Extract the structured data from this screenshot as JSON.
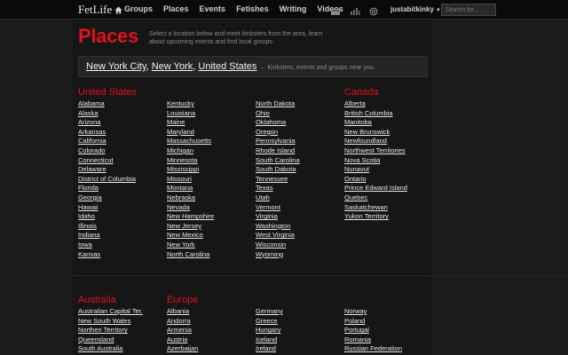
{
  "header": {
    "logo": "FetLife",
    "nav": [
      "Groups",
      "Places",
      "Events",
      "Fetishes",
      "Writing",
      "Videos"
    ],
    "username": "justabitkinky",
    "search_placeholder": "Search for..."
  },
  "page": {
    "title": "Places",
    "subtitle": "Select a location below and meet kinksters from the area, learn about upcoming events and find local groups."
  },
  "current_location": {
    "city": "New York City",
    "state": "New York",
    "country": "United States",
    "note": "← Kinksters, events and groups near you."
  },
  "regions": {
    "united_states": {
      "title": "United States",
      "columns": [
        [
          "Alabama",
          "Alaska",
          "Arizona",
          "Arkansas",
          "California",
          "Colorado",
          "Connecticut",
          "Delaware",
          "District of Columbia",
          "Florida",
          "Georgia",
          "Hawaii",
          "Idaho",
          "Illinois",
          "Indiana",
          "Iowa",
          "Kansas"
        ],
        [
          "Kentucky",
          "Louisiana",
          "Maine",
          "Maryland",
          "Massachusetts",
          "Michigan",
          "Minnesota",
          "Mississippi",
          "Missouri",
          "Montana",
          "Nebraska",
          "Nevada",
          "New Hampshire",
          "New Jersey",
          "New Mexico",
          "New York",
          "North Carolina"
        ],
        [
          "North Dakota",
          "Ohio",
          "Oklahoma",
          "Oregon",
          "Pennsylvania",
          "Rhode Island",
          "South Carolina",
          "South Dakota",
          "Tennessee",
          "Texas",
          "Utah",
          "Vermont",
          "Virginia",
          "Washington",
          "West Virginia",
          "Wisconsin",
          "Wyoming"
        ]
      ]
    },
    "canada": {
      "title": "Canada",
      "items": [
        "Alberta",
        "British Columbia",
        "Manitoba",
        "New Brunswick",
        "Newfoundland",
        "Northwest Territories",
        "Nova Scotia",
        "Nunavut",
        "Ontario",
        "Prince Edward Island",
        "Quebec",
        "Saskatchewan",
        "Yukon Territory"
      ]
    },
    "australia": {
      "title": "Australia",
      "items": [
        "Australian Capital Ter.",
        "New South Wales",
        "Northen Territory",
        "Queensland",
        "South Australia"
      ]
    },
    "europe": {
      "title": "Europe",
      "columns": [
        [
          "Albania",
          "Andorra",
          "Armenia",
          "Austria",
          "Azerbaijan"
        ],
        [
          "Germany",
          "Greece",
          "Hungary",
          "Iceland",
          "Ireland"
        ],
        [
          "Norway",
          "Poland",
          "Portugal",
          "Romania",
          "Russian Federation"
        ]
      ]
    }
  },
  "colors": {
    "accent": "#e0121a",
    "background": "#1b1b1b",
    "header": "#0a0a0a"
  }
}
